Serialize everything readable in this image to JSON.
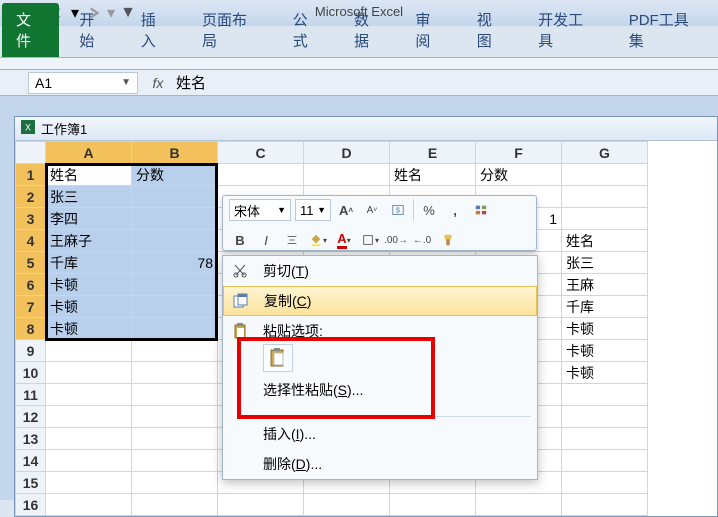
{
  "app": {
    "title": "Microsoft Excel"
  },
  "qat": {
    "excel": "excel-icon",
    "save": "save-icon",
    "undo": "undo-icon",
    "redo": "redo-icon"
  },
  "ribbon": {
    "file": "文件",
    "tabs": [
      "开始",
      "插入",
      "页面布局",
      "公式",
      "数据",
      "审阅",
      "视图",
      "开发工具",
      "PDF工具集"
    ]
  },
  "name_box": {
    "value": "A1"
  },
  "formula_bar": {
    "fx": "fx",
    "value": "姓名"
  },
  "workbook": {
    "title": "工作簿1"
  },
  "columns": [
    "A",
    "B",
    "C",
    "D",
    "E",
    "F",
    "G"
  ],
  "rows": [
    1,
    2,
    3,
    4,
    5,
    6,
    7,
    8,
    9,
    10,
    11,
    12,
    13,
    14,
    15,
    16
  ],
  "cells": {
    "A1": "姓名",
    "B1": "分数",
    "A2": "张三",
    "A3": "李四",
    "A4": "王麻子",
    "A5": "千库",
    "B5": "78",
    "A6": "卡顿",
    "A7": "卡顿",
    "A8": "卡顿",
    "E1": "姓名",
    "F1": "分数",
    "F3": "1",
    "G4": "姓名",
    "G5": "张三",
    "G6": "王麻",
    "G7": "千库",
    "G8": "卡顿",
    "G9": "卡顿",
    "G10": "卡顿"
  },
  "selection": {
    "range": "A1:B8",
    "active": "A1"
  },
  "mini_toolbar": {
    "font": "宋体",
    "size": "11",
    "increase": "A",
    "decrease": "A",
    "bold": "B",
    "italic": "I"
  },
  "context_menu": {
    "cut": "剪切(T)",
    "copy": "复制(C)",
    "paste_options_label": "粘贴选项:",
    "paste_special": "选择性粘贴(S)...",
    "insert": "插入(I)...",
    "delete": "删除(D)..."
  }
}
